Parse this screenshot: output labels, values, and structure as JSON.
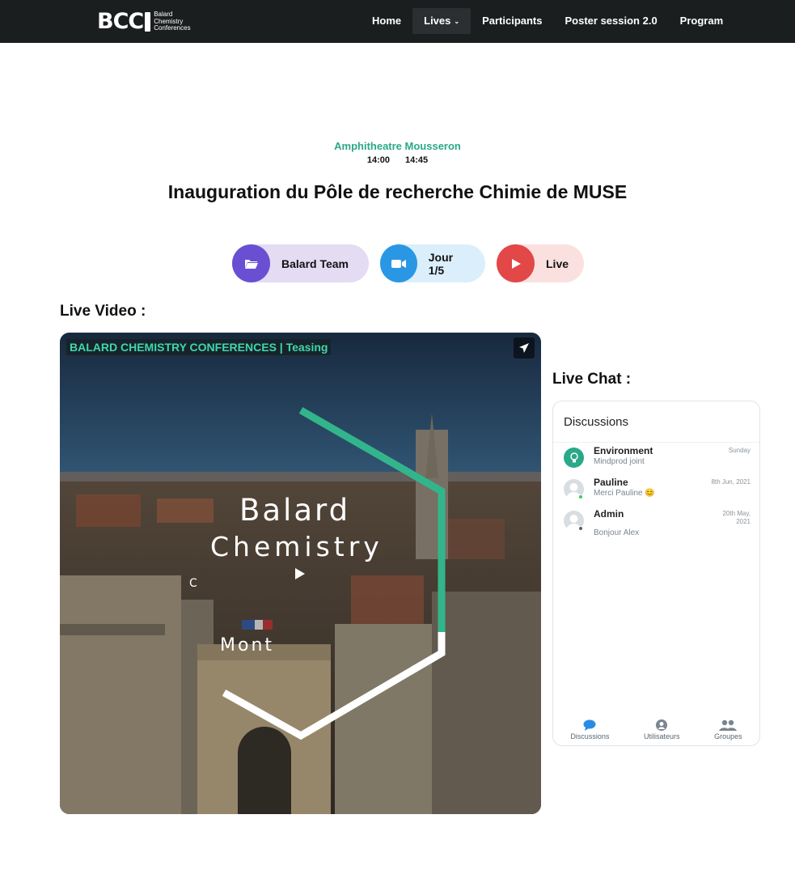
{
  "nav": {
    "logo_mark": "BCC",
    "logo_lines": [
      "Balard",
      "Chemistry",
      "Conferences"
    ],
    "items": [
      {
        "label": "Home"
      },
      {
        "label": "Lives",
        "has_dropdown": true
      },
      {
        "label": "Participants"
      },
      {
        "label": "Poster session 2.0"
      },
      {
        "label": "Program"
      }
    ]
  },
  "event": {
    "venue": "Amphitheatre Mousseron",
    "start_time": "14:00",
    "end_time": "14:45",
    "title": "Inauguration du Pôle de recherche Chimie de MUSE"
  },
  "pills": [
    {
      "label": "Balard Team",
      "icon": "folder-icon",
      "color": "#6a4fd3"
    },
    {
      "label": "Jour 1/5",
      "icon": "video-camera-icon",
      "color": "#2a97e5"
    },
    {
      "label": "Live",
      "icon": "play-icon",
      "color": "#e24848"
    }
  ],
  "video_section": {
    "heading": "Live Video :",
    "video_title": "BALARD CHEMISTRY CONFERENCES | Teasing",
    "overlay_lines": [
      "Balard",
      "Chemistry",
      "C",
      "Mont"
    ]
  },
  "chat_section": {
    "heading": "Live Chat :",
    "panel_title": "Discussions",
    "conversations": [
      {
        "name": "Environment",
        "message": "Mindprod joint",
        "date": "Sunday"
      },
      {
        "name": "Pauline",
        "message": "Merci Pauline 😊",
        "date": "8th Jun, 2021"
      },
      {
        "name": "Admin",
        "message": "Bonjour Alex",
        "date": "20th May,\n2021"
      }
    ],
    "footer": [
      {
        "label": "Discussions",
        "icon": "chat-bubble-icon"
      },
      {
        "label": "Utilisateurs",
        "icon": "user-icon"
      },
      {
        "label": "Groupes",
        "icon": "group-icon"
      }
    ]
  },
  "colors": {
    "nav_bg": "#1b1e1f",
    "accent_green": "#2aa889",
    "video_title_color": "#3fd6ae"
  }
}
